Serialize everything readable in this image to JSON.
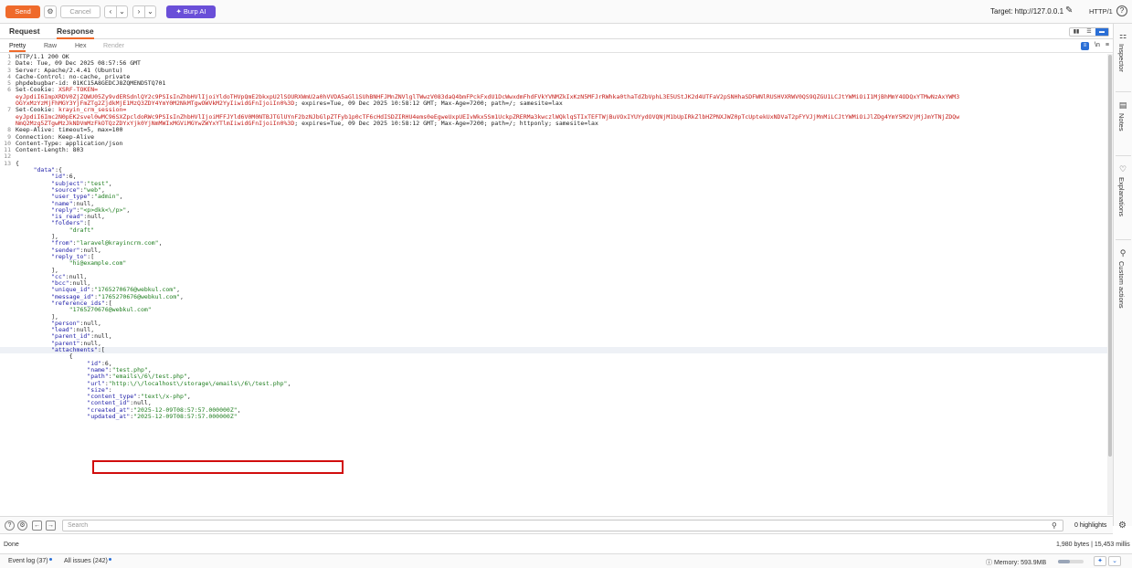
{
  "toolbar": {
    "send_label": "Send",
    "cancel_label": "Cancel",
    "burpai_label": "Burp AI",
    "target_label": "Target: http://127.0.0.1",
    "protocol_label": "HTTP/1",
    "help_label": "?"
  },
  "tabs": {
    "request": "Request",
    "response": "Response"
  },
  "view_tabs": {
    "pretty": "Pretty",
    "raw": "Raw",
    "hex": "Hex",
    "render": "Render",
    "ln_label": "\\n"
  },
  "response_lines": [
    {
      "n": "1",
      "segs": [
        {
          "t": "HTTP/1.1 200 OK",
          "c": "hdr-name"
        }
      ]
    },
    {
      "n": "2",
      "segs": [
        {
          "t": "Date: Tue, 09 Dec 2025 08:57:56 GMT",
          "c": "hdr-name"
        }
      ]
    },
    {
      "n": "3",
      "segs": [
        {
          "t": "Server: Apache/2.4.41 (Ubuntu)",
          "c": "hdr-name"
        }
      ]
    },
    {
      "n": "4",
      "segs": [
        {
          "t": "Cache-Control: no-cache, private",
          "c": "hdr-name"
        }
      ]
    },
    {
      "n": "5",
      "segs": [
        {
          "t": "phpdebugbar-id: 01KC15A8GEDCJ8ZQMEND5TQ701",
          "c": "hdr-name"
        }
      ]
    },
    {
      "n": "6",
      "segs": [
        {
          "t": "Set-Cookie: ",
          "c": "hdr-name"
        },
        {
          "t": "XSRF-TOKEN=",
          "c": "cookie"
        }
      ]
    },
    {
      "n": "",
      "segs": [
        {
          "t": "eyJpdiI6ImpXRDV0ZjZQWU05Zy9vdERSdnlQY2c9PSIsInZhbHVlIjoiYldoTHVpQmE2bkxpU2lSOURXWmU2a0hVVDA5aGl1SUhBNHFJMnZNVlglTWwzV083daQ4bmFPckFxdU1DcWwxdmFhdFVkYVNMZkIxKzN5MFJrRWhka0thaTdZbVphL3E5UStJK2d4UTFaV2pSNHhaSDFWNlRUSHVXRWV0QS9QZGU1LCJtYWMiOiI1MjBhMmY4ODQxYTMwNzAxYWM3",
          "c": "cookie"
        }
      ]
    },
    {
      "n": "",
      "segs": [
        {
          "t": "OGYxMzYzMjFhMGY3YjFmZTg2ZjdkMjE1MzQ3ZDY4YmY0M2NkMTgwOWVkM2YyIiwidGFnIjoiIn0%3D",
          "c": "cookie"
        },
        {
          "t": "; expires=Tue, 09 Dec 2025 10:58:12 GMT; Max-Age=7200; path=/; samesite=lax",
          "c": "hdr-name"
        }
      ]
    },
    {
      "n": "7",
      "segs": [
        {
          "t": "Set-Cookie: ",
          "c": "hdr-name"
        },
        {
          "t": "krayin_crm_session=",
          "c": "cookie"
        }
      ]
    },
    {
      "n": "",
      "segs": [
        {
          "t": "eyJpdiI6Imc2N0pEK2svel0wMC96SXZpcldoRWc9PSIsInZhbHVlIjoiMFFJYld6V0M0NTBJTGlUYnF2bzNJbGlpZTFyb1p0cTF6cHdISDZIRHU4ems0eEgweUxpUEIvWkx5Sm1UckpZRERMa3kwczlWQklqSTIxTEFTWjBuVOxIYUYydOVQNjM1bUpIRkZlbHZPNXJWZ0pTcUptekUxNDVaT2pFYVJjMnMiLCJtYWMiOiJlZDg4YmY5M2VjMjJmYTNjZDQw",
          "c": "cookie"
        }
      ]
    },
    {
      "n": "",
      "segs": [
        {
          "t": "NmQ2Mzg5ZTgwMzJkNDVmMzFkOTQzZDYxYjk0YjNmMWIxMGViMGYwZWYxYTlmIiwidGFnIjoiIn0%3D",
          "c": "cookie"
        },
        {
          "t": "; expires=Tue, 09 Dec 2025 10:58:12 GMT; Max-Age=7200; path=/; httponly; samesite=lax",
          "c": "hdr-name"
        }
      ]
    },
    {
      "n": "8",
      "segs": [
        {
          "t": "Keep-Alive: timeout=5, max=100",
          "c": "hdr-name"
        }
      ]
    },
    {
      "n": "9",
      "segs": [
        {
          "t": "Connection: Keep-Alive",
          "c": "hdr-name"
        }
      ]
    },
    {
      "n": "10",
      "segs": [
        {
          "t": "Content-Type: application/json",
          "c": "hdr-name"
        }
      ]
    },
    {
      "n": "11",
      "segs": [
        {
          "t": "Content-Length: 803",
          "c": "hdr-name"
        }
      ]
    },
    {
      "n": "12",
      "segs": []
    },
    {
      "n": "13",
      "segs": [
        {
          "t": "{",
          "c": "hdr-name"
        }
      ]
    },
    {
      "n": "",
      "segs": [
        {
          "t": "     ",
          "c": "hdr-name"
        },
        {
          "t": "\"data\"",
          "c": "key"
        },
        {
          "t": ":{",
          "c": "hdr-name"
        }
      ]
    },
    {
      "n": "",
      "segs": [
        {
          "t": "          ",
          "c": "hdr-name"
        },
        {
          "t": "\"id\"",
          "c": "key"
        },
        {
          "t": ":6,",
          "c": "hdr-name"
        }
      ]
    },
    {
      "n": "",
      "segs": [
        {
          "t": "          ",
          "c": "hdr-name"
        },
        {
          "t": "\"subject\"",
          "c": "key"
        },
        {
          "t": ":",
          "c": "hdr-name"
        },
        {
          "t": "\"test\"",
          "c": "str"
        },
        {
          "t": ",",
          "c": "hdr-name"
        }
      ]
    },
    {
      "n": "",
      "segs": [
        {
          "t": "          ",
          "c": "hdr-name"
        },
        {
          "t": "\"source\"",
          "c": "key"
        },
        {
          "t": ":",
          "c": "hdr-name"
        },
        {
          "t": "\"web\"",
          "c": "str"
        },
        {
          "t": ",",
          "c": "hdr-name"
        }
      ]
    },
    {
      "n": "",
      "segs": [
        {
          "t": "          ",
          "c": "hdr-name"
        },
        {
          "t": "\"user_type\"",
          "c": "key"
        },
        {
          "t": ":",
          "c": "hdr-name"
        },
        {
          "t": "\"admin\"",
          "c": "str"
        },
        {
          "t": ",",
          "c": "hdr-name"
        }
      ]
    },
    {
      "n": "",
      "segs": [
        {
          "t": "          ",
          "c": "hdr-name"
        },
        {
          "t": "\"name\"",
          "c": "key"
        },
        {
          "t": ":null,",
          "c": "hdr-name"
        }
      ]
    },
    {
      "n": "",
      "segs": [
        {
          "t": "          ",
          "c": "hdr-name"
        },
        {
          "t": "\"reply\"",
          "c": "key"
        },
        {
          "t": ":",
          "c": "hdr-name"
        },
        {
          "t": "\"<p>dkk<\\/p>\"",
          "c": "str"
        },
        {
          "t": ",",
          "c": "hdr-name"
        }
      ]
    },
    {
      "n": "",
      "segs": [
        {
          "t": "          ",
          "c": "hdr-name"
        },
        {
          "t": "\"is_read\"",
          "c": "key"
        },
        {
          "t": ":null,",
          "c": "hdr-name"
        }
      ]
    },
    {
      "n": "",
      "segs": [
        {
          "t": "          ",
          "c": "hdr-name"
        },
        {
          "t": "\"folders\"",
          "c": "key"
        },
        {
          "t": ":[",
          "c": "hdr-name"
        }
      ]
    },
    {
      "n": "",
      "segs": [
        {
          "t": "               ",
          "c": "hdr-name"
        },
        {
          "t": "\"draft\"",
          "c": "str"
        }
      ]
    },
    {
      "n": "",
      "segs": [
        {
          "t": "          ],",
          "c": "hdr-name"
        }
      ]
    },
    {
      "n": "",
      "segs": [
        {
          "t": "          ",
          "c": "hdr-name"
        },
        {
          "t": "\"from\"",
          "c": "key"
        },
        {
          "t": ":",
          "c": "hdr-name"
        },
        {
          "t": "\"laravel@krayincrm.com\"",
          "c": "str"
        },
        {
          "t": ",",
          "c": "hdr-name"
        }
      ]
    },
    {
      "n": "",
      "segs": [
        {
          "t": "          ",
          "c": "hdr-name"
        },
        {
          "t": "\"sender\"",
          "c": "key"
        },
        {
          "t": ":null,",
          "c": "hdr-name"
        }
      ]
    },
    {
      "n": "",
      "segs": [
        {
          "t": "          ",
          "c": "hdr-name"
        },
        {
          "t": "\"reply_to\"",
          "c": "key"
        },
        {
          "t": ":[",
          "c": "hdr-name"
        }
      ]
    },
    {
      "n": "",
      "segs": [
        {
          "t": "               ",
          "c": "hdr-name"
        },
        {
          "t": "\"hi@example.com\"",
          "c": "str"
        }
      ]
    },
    {
      "n": "",
      "segs": [
        {
          "t": "          ],",
          "c": "hdr-name"
        }
      ]
    },
    {
      "n": "",
      "segs": [
        {
          "t": "          ",
          "c": "hdr-name"
        },
        {
          "t": "\"cc\"",
          "c": "key"
        },
        {
          "t": ":null,",
          "c": "hdr-name"
        }
      ]
    },
    {
      "n": "",
      "segs": [
        {
          "t": "          ",
          "c": "hdr-name"
        },
        {
          "t": "\"bcc\"",
          "c": "key"
        },
        {
          "t": ":null,",
          "c": "hdr-name"
        }
      ]
    },
    {
      "n": "",
      "segs": [
        {
          "t": "          ",
          "c": "hdr-name"
        },
        {
          "t": "\"unique_id\"",
          "c": "key"
        },
        {
          "t": ":",
          "c": "hdr-name"
        },
        {
          "t": "\"1765270676@webkul.com\"",
          "c": "str"
        },
        {
          "t": ",",
          "c": "hdr-name"
        }
      ]
    },
    {
      "n": "",
      "segs": [
        {
          "t": "          ",
          "c": "hdr-name"
        },
        {
          "t": "\"message_id\"",
          "c": "key"
        },
        {
          "t": ":",
          "c": "hdr-name"
        },
        {
          "t": "\"1765270676@webkul.com\"",
          "c": "str"
        },
        {
          "t": ",",
          "c": "hdr-name"
        }
      ]
    },
    {
      "n": "",
      "segs": [
        {
          "t": "          ",
          "c": "hdr-name"
        },
        {
          "t": "\"reference_ids\"",
          "c": "key"
        },
        {
          "t": ":[",
          "c": "hdr-name"
        }
      ]
    },
    {
      "n": "",
      "segs": [
        {
          "t": "               ",
          "c": "hdr-name"
        },
        {
          "t": "\"1765270676@webkul.com\"",
          "c": "str"
        }
      ]
    },
    {
      "n": "",
      "segs": [
        {
          "t": "          ],",
          "c": "hdr-name"
        }
      ]
    },
    {
      "n": "",
      "segs": [
        {
          "t": "          ",
          "c": "hdr-name"
        },
        {
          "t": "\"person\"",
          "c": "key"
        },
        {
          "t": ":null,",
          "c": "hdr-name"
        }
      ]
    },
    {
      "n": "",
      "segs": [
        {
          "t": "          ",
          "c": "hdr-name"
        },
        {
          "t": "\"lead\"",
          "c": "key"
        },
        {
          "t": ":null,",
          "c": "hdr-name"
        }
      ]
    },
    {
      "n": "",
      "segs": [
        {
          "t": "          ",
          "c": "hdr-name"
        },
        {
          "t": "\"parent_id\"",
          "c": "key"
        },
        {
          "t": ":null,",
          "c": "hdr-name"
        }
      ]
    },
    {
      "n": "",
      "segs": [
        {
          "t": "          ",
          "c": "hdr-name"
        },
        {
          "t": "\"parent\"",
          "c": "key"
        },
        {
          "t": ":null,",
          "c": "hdr-name"
        }
      ]
    },
    {
      "n": "",
      "hl": true,
      "segs": [
        {
          "t": "          ",
          "c": "hdr-name"
        },
        {
          "t": "\"attachments\"",
          "c": "key"
        },
        {
          "t": ":[",
          "c": "hdr-name"
        }
      ]
    },
    {
      "n": "",
      "segs": [
        {
          "t": "               {",
          "c": "hdr-name"
        }
      ]
    },
    {
      "n": "",
      "segs": [
        {
          "t": "                    ",
          "c": "hdr-name"
        },
        {
          "t": "\"id\"",
          "c": "key"
        },
        {
          "t": ":6,",
          "c": "hdr-name"
        }
      ]
    },
    {
      "n": "",
      "segs": [
        {
          "t": "                    ",
          "c": "hdr-name"
        },
        {
          "t": "\"name\"",
          "c": "key"
        },
        {
          "t": ":",
          "c": "hdr-name"
        },
        {
          "t": "\"test.php\"",
          "c": "str"
        },
        {
          "t": ",",
          "c": "hdr-name"
        }
      ]
    },
    {
      "n": "",
      "segs": [
        {
          "t": "                    ",
          "c": "hdr-name"
        },
        {
          "t": "\"path\"",
          "c": "key"
        },
        {
          "t": ":",
          "c": "hdr-name"
        },
        {
          "t": "\"emails\\/6\\/test.php\"",
          "c": "str"
        },
        {
          "t": ",",
          "c": "hdr-name"
        }
      ]
    },
    {
      "n": "",
      "segs": [
        {
          "t": "                    ",
          "c": "hdr-name"
        },
        {
          "t": "\"url\"",
          "c": "key"
        },
        {
          "t": ":",
          "c": "hdr-name"
        },
        {
          "t": "\"http:\\/\\/localhost\\/storage\\/emails\\/6\\/test.php\"",
          "c": "str"
        },
        {
          "t": ",",
          "c": "hdr-name"
        }
      ]
    },
    {
      "n": "",
      "segs": [
        {
          "t": "                    ",
          "c": "hdr-name"
        },
        {
          "t": "\"size\"",
          "c": "key"
        },
        {
          "t": ":",
          "c": "hdr-name"
        }
      ]
    },
    {
      "n": "",
      "segs": [
        {
          "t": "                    ",
          "c": "hdr-name"
        },
        {
          "t": "\"content_type\"",
          "c": "key"
        },
        {
          "t": ":",
          "c": "hdr-name"
        },
        {
          "t": "\"text\\/x-php\"",
          "c": "str"
        },
        {
          "t": ",",
          "c": "hdr-name"
        }
      ]
    },
    {
      "n": "",
      "segs": [
        {
          "t": "                    ",
          "c": "hdr-name"
        },
        {
          "t": "\"content_id\"",
          "c": "key"
        },
        {
          "t": ":null,",
          "c": "hdr-name"
        }
      ]
    },
    {
      "n": "",
      "segs": [
        {
          "t": "                    ",
          "c": "hdr-name"
        },
        {
          "t": "\"created_at\"",
          "c": "key"
        },
        {
          "t": ":",
          "c": "hdr-name"
        },
        {
          "t": "\"2025-12-09T08:57:57.000000Z\"",
          "c": "str"
        },
        {
          "t": ",",
          "c": "hdr-name"
        }
      ]
    },
    {
      "n": "",
      "segs": [
        {
          "t": "                    ",
          "c": "hdr-name"
        },
        {
          "t": "\"updated_at\"",
          "c": "key"
        },
        {
          "t": ":",
          "c": "hdr-name"
        },
        {
          "t": "\"2025-12-09T08:57:57.000000Z\"",
          "c": "str"
        }
      ]
    }
  ],
  "sidebar": {
    "items": [
      {
        "label": "Inspector"
      },
      {
        "label": "Notes"
      },
      {
        "label": "Explanations"
      },
      {
        "label": "Custom actions"
      }
    ]
  },
  "search": {
    "placeholder": "Search",
    "highlights": "0 highlights"
  },
  "status": {
    "left": "Done",
    "right": "1,980 bytes | 15,453 millis"
  },
  "bottombar": {
    "event_log": "Event log (37)",
    "all_issues": "All issues (242)",
    "memory": "Memory: 593.9MB",
    "memory_fraction": 0.45
  },
  "colors": {
    "accent": "#ef6a2a",
    "burpai": "#6a4fd8",
    "selected": "#2b6fd6",
    "highlight_box": "#d10d0d"
  }
}
